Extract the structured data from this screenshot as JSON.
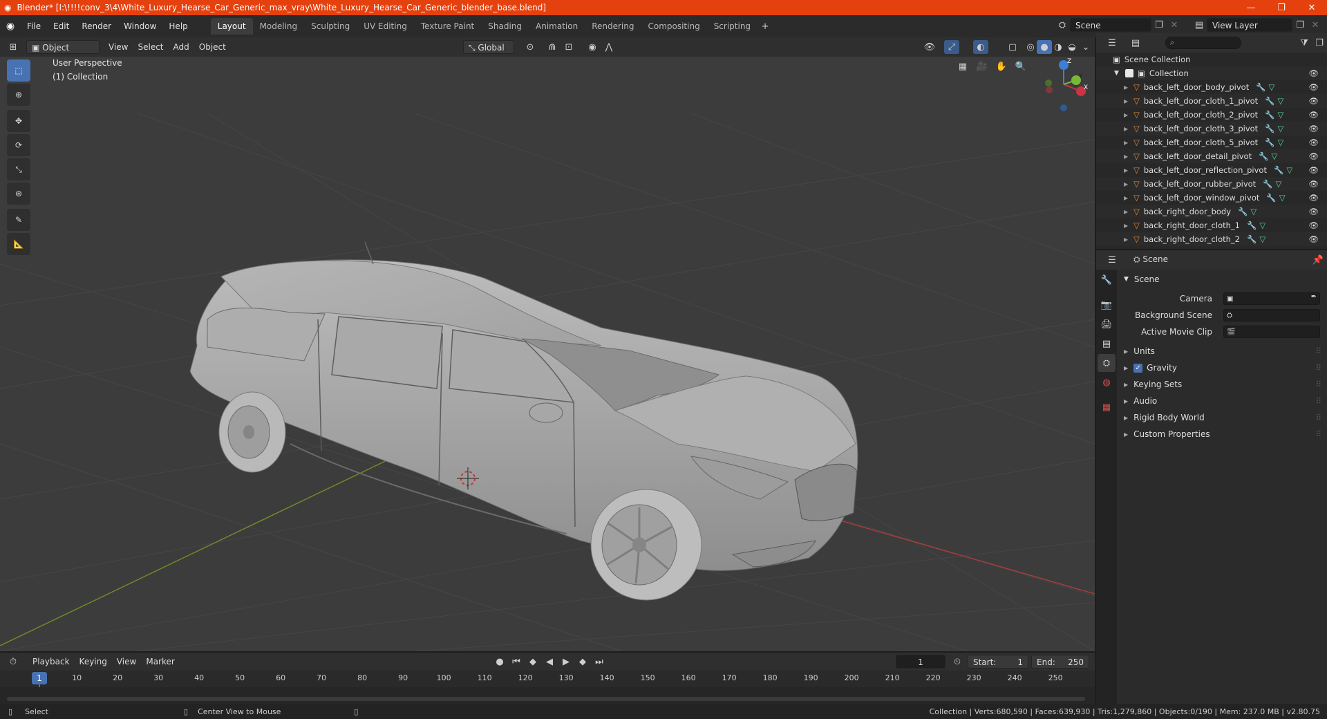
{
  "title_bar": {
    "title": "Blender* [I:\\!!!!conv_3\\4\\White_Luxury_Hearse_Car_Generic_max_vray\\White_Luxury_Hearse_Car_Generic_blender_base.blend]",
    "accent": "#e5410e"
  },
  "menus": [
    "File",
    "Edit",
    "Render",
    "Window",
    "Help"
  ],
  "workspaces": [
    "Layout",
    "Modeling",
    "Sculpting",
    "UV Editing",
    "Texture Paint",
    "Shading",
    "Animation",
    "Rendering",
    "Compositing",
    "Scripting"
  ],
  "active_workspace": "Layout",
  "scene_selector": "Scene",
  "view_layer_selector": "View Layer",
  "viewport_header": {
    "mode": "Object Mode",
    "menus": [
      "View",
      "Select",
      "Add",
      "Object"
    ],
    "orientation": "Global"
  },
  "viewport": {
    "perspective_label": "User Perspective",
    "collection_label": "(1) Collection",
    "gizmo_axes": [
      "X",
      "Y",
      "Z"
    ],
    "grid_color": "#464646",
    "x_axis_color": "#a83d3d",
    "y_axis_color": "#6f8a2a",
    "active_tool_color": "#4772b3",
    "tools": [
      "select-box-icon",
      "cursor-icon",
      "move-icon",
      "rotate-icon",
      "scale-icon",
      "transform-icon",
      "annotate-icon",
      "measure-icon"
    ]
  },
  "timeline": {
    "menus": [
      "Playback",
      "Keying",
      "View",
      "Marker"
    ],
    "current_frame": "1",
    "start_label": "Start:",
    "start": "1",
    "end_label": "End:",
    "end": "250",
    "ruler_ticks": [
      "1",
      "10",
      "20",
      "30",
      "40",
      "50",
      "60",
      "70",
      "80",
      "90",
      "100",
      "110",
      "120",
      "130",
      "140",
      "150",
      "160",
      "170",
      "180",
      "190",
      "200",
      "210",
      "220",
      "230",
      "240",
      "250"
    ]
  },
  "status_bar": {
    "left_action": "Select",
    "middle_action": "Center View to Mouse",
    "stats": "Collection | Verts:680,590 | Faces:639,930 | Tris:1,279,860 | Objects:0/190 | Mem: 237.0 MB | v2.80.75"
  },
  "outliner": {
    "root": "Scene Collection",
    "collection": "Collection",
    "objects": [
      "back_left_door_body_pivot",
      "back_left_door_cloth_1_pivot",
      "back_left_door_cloth_2_pivot",
      "back_left_door_cloth_3_pivot",
      "back_left_door_cloth_5_pivot",
      "back_left_door_detail_pivot",
      "back_left_door_reflection_pivot",
      "back_left_door_rubber_pivot",
      "back_left_door_window_pivot",
      "back_right_door_body",
      "back_right_door_cloth_1",
      "back_right_door_cloth_2"
    ]
  },
  "properties": {
    "breadcrumb": "Scene",
    "panel_title": "Scene",
    "fields": [
      {
        "label": "Camera",
        "value": ""
      },
      {
        "label": "Background Scene",
        "value": ""
      },
      {
        "label": "Active Movie Clip",
        "value": ""
      }
    ],
    "sections": [
      "Units",
      "Gravity",
      "Keying Sets",
      "Audio",
      "Rigid Body World",
      "Custom Properties"
    ],
    "gravity_checked": true
  }
}
